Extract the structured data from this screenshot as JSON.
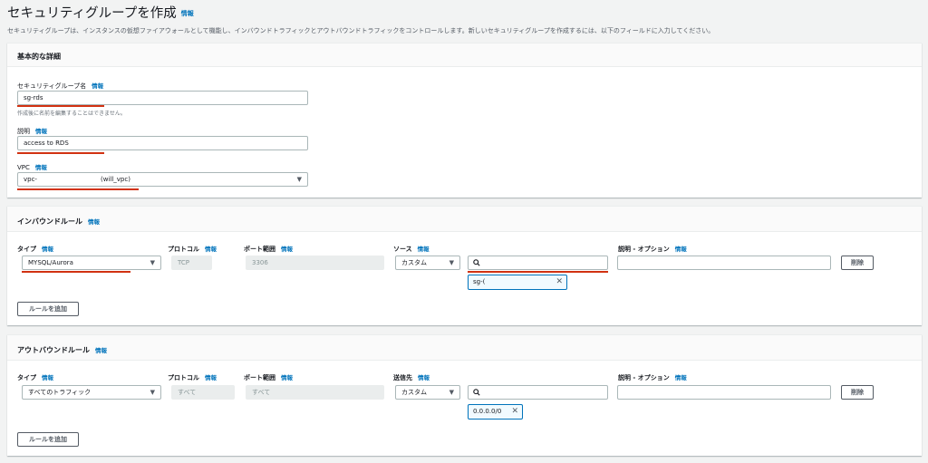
{
  "page": {
    "title": "セキュリティグループを作成",
    "info": "情報",
    "description": "セキュリティグループは、インスタンスの仮想ファイアウォールとして機能し、インバウンドトラフィックとアウトバウンドトラフィックをコントロールします。新しいセキュリティグループを作成するには、以下のフィールドに入力してください。"
  },
  "basic": {
    "title": "基本的な詳細",
    "name_label": "セキュリティグループ名",
    "name_value": "sg-rds",
    "name_hint": "作成後に名前を編集することはできません。",
    "desc_label": "説明",
    "desc_value": "access to RDS",
    "vpc_label": "VPC",
    "vpc_value_prefix": "vpc-",
    "vpc_value_suffix": "(will_vpc)",
    "info": "情報"
  },
  "inbound": {
    "title": "インバウンドルール",
    "info": "情報",
    "col_type": "タイプ",
    "col_protocol": "プロトコル",
    "col_port": "ポート範囲",
    "col_source": "ソース",
    "col_desc": "説明 - オプション",
    "type_value": "MYSQL/Aurora",
    "protocol_value": "TCP",
    "port_value": "3306",
    "source_value": "カスタム",
    "search_value": "",
    "token_value": "sg-(",
    "delete_label": "削除",
    "add_label": "ルールを追加"
  },
  "outbound": {
    "title": "アウトバウンドルール",
    "info": "情報",
    "col_type": "タイプ",
    "col_protocol": "プロトコル",
    "col_port": "ポート範囲",
    "col_dest": "送信先",
    "col_desc": "説明 - オプション",
    "type_value": "すべてのトラフィック",
    "protocol_value": "すべて",
    "port_value": "すべて",
    "dest_value": "カスタム",
    "token_value": "0.0.0.0/0",
    "delete_label": "削除",
    "add_label": "ルールを追加"
  },
  "icons": {
    "caret": "▼",
    "close": "✕"
  },
  "colors": {
    "accent": "#0073bb",
    "annotation": "#d13212"
  }
}
